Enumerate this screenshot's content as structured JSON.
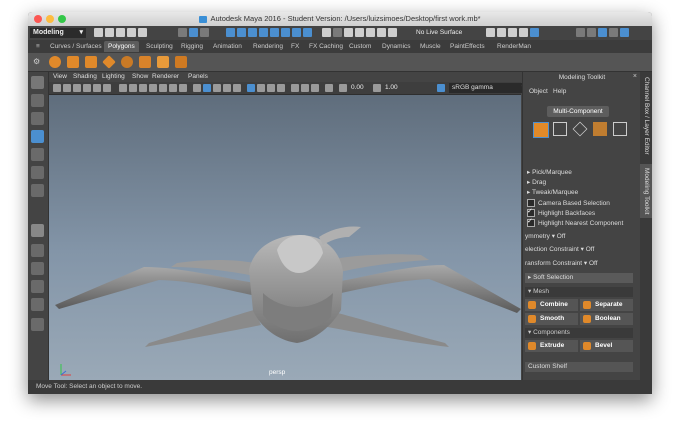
{
  "window": {
    "title": "Autodesk Maya 2016 - Student Version: /Users/luizsimoes/Desktop/first work.mb*",
    "traffic_lights": [
      "#fc5753",
      "#fdbc40",
      "#33c748"
    ]
  },
  "status_line": {
    "menu_set": "Modeling",
    "live_surface": "No Live Surface"
  },
  "shelf": {
    "tabs": [
      "Curves / Surfaces",
      "Polygons",
      "Sculpting",
      "Rigging",
      "Animation",
      "Rendering",
      "FX",
      "FX Caching",
      "Custom",
      "Dynamics",
      "Muscle",
      "PaintEffects",
      "RenderMan"
    ],
    "active_tab": "Polygons"
  },
  "panel": {
    "menus": [
      "View",
      "Shading",
      "Lighting",
      "Show",
      "Renderer",
      "Panels"
    ],
    "value_a": "0.00",
    "value_b": "1.00",
    "color_space": "sRGB gamma",
    "camera_label": "persp"
  },
  "toolkit": {
    "title": "Modeling Toolkit",
    "menus": [
      "Object",
      "Help"
    ],
    "mode_button": "Multi-Component",
    "options": [
      "Pick/Marquee",
      "Drag",
      "Tweak/Marquee"
    ],
    "checks": [
      {
        "label": "Camera Based Selection",
        "checked": false
      },
      {
        "label": "Highlight Backfaces",
        "checked": true
      },
      {
        "label": "Highlight Nearest Component",
        "checked": true
      }
    ],
    "symmetry": "ymmetry",
    "symmetry_value": "Off",
    "selection_constraint": "election Constraint",
    "selection_constraint_value": "Off",
    "transform_constraint": "ransform Constraint",
    "transform_constraint_value": "Off",
    "soft_selection": "Soft Selection",
    "mesh_header": "Mesh",
    "mesh_buttons": [
      "Combine",
      "Separate",
      "Smooth",
      "Boolean"
    ],
    "components_header": "Components",
    "component_buttons": [
      "Extrude",
      "Bevel"
    ],
    "custom_shelf": "Custom Shelf"
  },
  "side_tabs": [
    "Channel Box / Layer Editor",
    "Modeling Toolkit"
  ],
  "help_line": "Move Tool: Select an object to move."
}
